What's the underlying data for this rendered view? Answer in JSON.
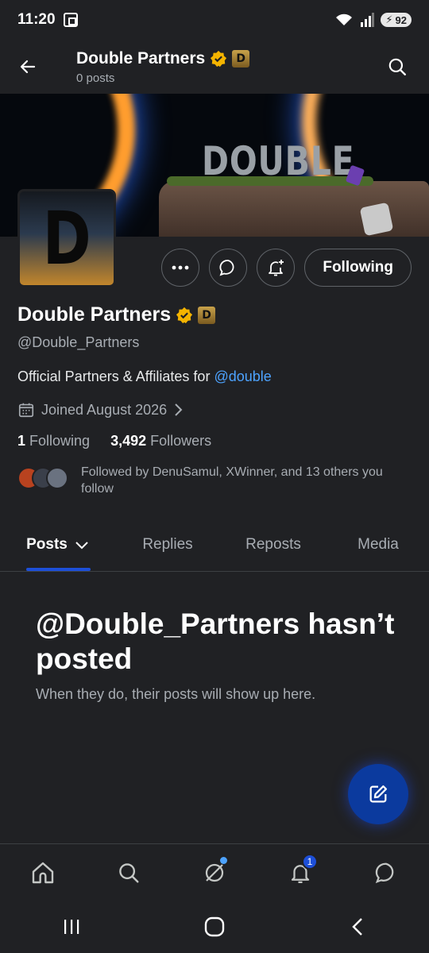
{
  "status_bar": {
    "time": "11:20",
    "battery": "92"
  },
  "header": {
    "title": "Double Partners",
    "posts_count": "0 posts"
  },
  "banner": {
    "word": "DOUBLE"
  },
  "avatar": {
    "letter": "D"
  },
  "actions": {
    "following_label": "Following"
  },
  "profile": {
    "name": "Double Partners",
    "handle": "@Double_Partners",
    "bio_text": "Official Partners & Affiliates for ",
    "bio_link": "@double",
    "joined": "Joined August 2026",
    "following_count": "1",
    "following_label": "Following",
    "followers_count": "3,492",
    "followers_label": "Followers",
    "followed_by": "Followed by DenuSamul, XWinner, and 13 others you follow",
    "affiliate_badge_letter": "D"
  },
  "tabs": [
    {
      "label": "Posts"
    },
    {
      "label": "Replies"
    },
    {
      "label": "Reposts"
    },
    {
      "label": "Media"
    }
  ],
  "empty_state": {
    "title": "@Double_Partners hasn’t posted",
    "subtitle": "When they do, their posts will show up here."
  },
  "bottom_nav": {
    "notifications_badge": "1"
  },
  "colors": {
    "accent": "#1d4fd8",
    "link": "#4da3ff",
    "background": "#202124",
    "verified": "#f4b400"
  }
}
